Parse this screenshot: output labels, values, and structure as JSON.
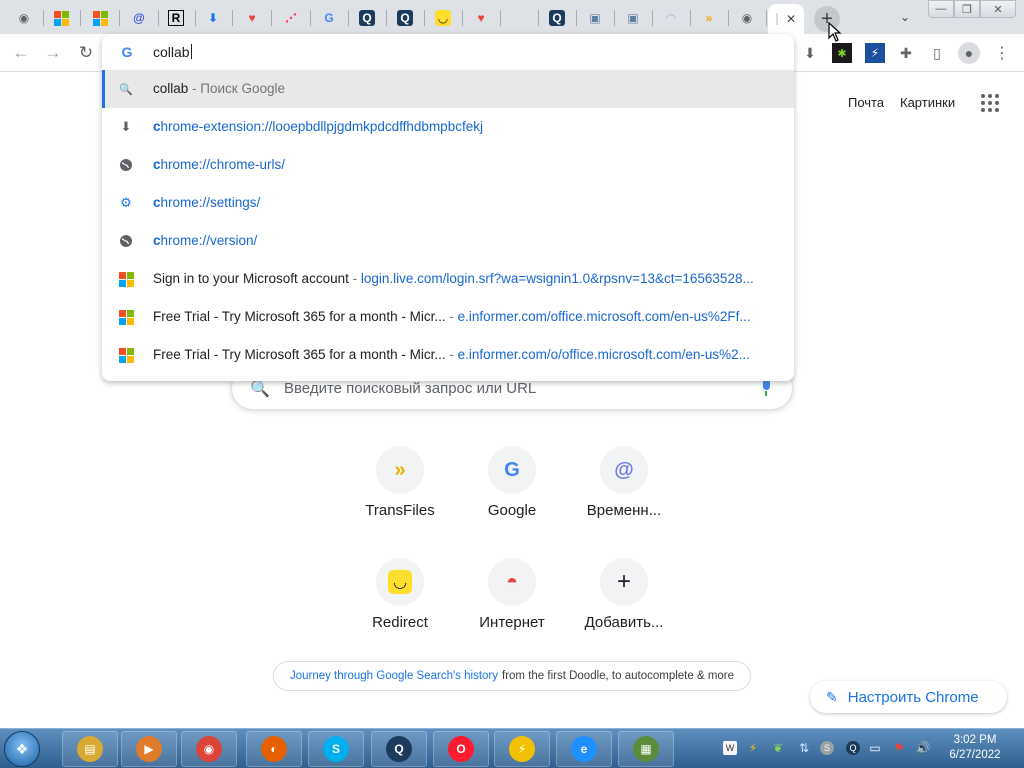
{
  "tabs": [
    {
      "icon": "chrome-icon",
      "glyph": "◉",
      "color": "#5f6368"
    },
    {
      "icon": "microsoft-icon",
      "glyph": "ms",
      "color": ""
    },
    {
      "icon": "microsoft-icon",
      "glyph": "ms",
      "color": ""
    },
    {
      "icon": "at-sign-icon",
      "glyph": "@",
      "color": "#3c50e0"
    },
    {
      "icon": "r-logo-icon",
      "glyph": "R",
      "color": "#000000"
    },
    {
      "icon": "download-icon",
      "glyph": "⬇",
      "color": "#1a73e8"
    },
    {
      "icon": "heart-app-icon",
      "glyph": "♥",
      "color": "#e8453c"
    },
    {
      "icon": "monday-icon",
      "glyph": "⋰",
      "color": "#ff3d57"
    },
    {
      "icon": "google-icon",
      "glyph": "G",
      "color": "#4285f4"
    },
    {
      "icon": "q-search-icon",
      "glyph": "Q",
      "color": "#1b3a5c"
    },
    {
      "icon": "q-search-icon",
      "glyph": "Q",
      "color": "#1b3a5c"
    },
    {
      "icon": "smile-icon",
      "glyph": "◡",
      "color": "#222222"
    },
    {
      "icon": "heart-app-icon",
      "glyph": "♥",
      "color": "#e8453c"
    },
    {
      "icon": "blank-tab-icon",
      "glyph": "",
      "color": "#5f6368"
    },
    {
      "icon": "q-search-icon",
      "glyph": "Q",
      "color": "#1b3a5c"
    },
    {
      "icon": "box-icon",
      "glyph": "▣",
      "color": "#5f7fa0"
    },
    {
      "icon": "box-icon",
      "glyph": "▣",
      "color": "#5f7fa0"
    },
    {
      "icon": "arc-icon",
      "glyph": "◠",
      "color": "#9fb3d9"
    },
    {
      "icon": "transfiles-icon",
      "glyph": "»",
      "color": "#f2a900"
    },
    {
      "icon": "chrome-icon",
      "glyph": "◉",
      "color": "#5f6368"
    }
  ],
  "active_tab": {
    "close": "✕"
  },
  "new_tab": "+",
  "tab_search": "⌄",
  "window_controls": {
    "minimize": "—",
    "maximize": "❐",
    "close": "✕"
  },
  "toolbar": {
    "back": "←",
    "forward": "→",
    "reload": "↻"
  },
  "omnibox": {
    "input_value": "collab",
    "suggestions": [
      {
        "kind": "search",
        "icon": "search-icon",
        "glyph": "🔍",
        "main": "collab",
        "suffix": " - Поиск Google",
        "selected": true
      },
      {
        "kind": "download",
        "icon": "download-icon",
        "glyph": "⬇",
        "bold": "c",
        "url": "hrome-extension://looepbdllpjgdmkpdcdffhdbmpbcfekj"
      },
      {
        "kind": "globe",
        "icon": "globe-icon",
        "glyph": "🌐",
        "bold": "c",
        "url": "hrome://chrome-urls/"
      },
      {
        "kind": "gear",
        "icon": "gear-icon",
        "glyph": "⚙",
        "bold": "c",
        "url": "hrome://settings/"
      },
      {
        "kind": "globe",
        "icon": "globe-icon",
        "glyph": "🌐",
        "bold": "c",
        "url": "hrome://version/"
      },
      {
        "kind": "ms",
        "icon": "microsoft-icon",
        "title": "Sign in to your Microsoft account",
        "sep": " - ",
        "url": "login.live.com/login.srf?wa=wsignin1.0&rpsnv=13&ct=16563528..."
      },
      {
        "kind": "ms",
        "icon": "microsoft-icon",
        "title": "Free Trial - Try Microsoft 365 for a month - Micr...",
        "sep": " - ",
        "url": "e.informer.com/office.microsoft.com/en-us%2Ff..."
      },
      {
        "kind": "ms",
        "icon": "microsoft-icon",
        "title": "Free Trial - Try Microsoft 365 for a month - Micr...",
        "sep": " - ",
        "url": "e.informer.com/o/office.microsoft.com/en-us%2..."
      }
    ]
  },
  "ntp": {
    "links": {
      "mail": "Почта",
      "images": "Картинки"
    },
    "search_placeholder": "Введите поисковый запрос или URL",
    "tiles": [
      {
        "label": "TransFiles",
        "glyph": "»",
        "color": "#f2a900"
      },
      {
        "label": "Google",
        "glyph": "G",
        "color": "#4285f4"
      },
      {
        "label": "Временн...",
        "glyph": "@",
        "color": "#6b7ce8"
      },
      {
        "label": "Redirect",
        "glyph": "◡",
        "color": "#222222"
      },
      {
        "label": "Интернет",
        "glyph": "◓",
        "color": "#e8453c"
      },
      {
        "label": "Добавить...",
        "glyph": "+",
        "color": "#202124"
      }
    ],
    "doodle": {
      "link": "Journey through Google Search's history",
      "text": "from the first Doodle, to autocomplete & more"
    },
    "customize": "Настроить Chrome"
  },
  "taskbar": {
    "clock_time": "3:02 PM",
    "clock_date": "6/27/2022",
    "apps": [
      {
        "name": "file-explorer-icon",
        "color": "#d9a934",
        "glyph": "▤"
      },
      {
        "name": "media-player-icon",
        "color": "#e07b2a",
        "glyph": "▶"
      },
      {
        "name": "chrome-icon",
        "color": "#db4437",
        "glyph": "◉"
      },
      {
        "name": "firefox-icon",
        "color": "#e66000",
        "glyph": "◐"
      },
      {
        "name": "skype-icon",
        "color": "#00aff0",
        "glyph": "S"
      },
      {
        "name": "q-search-icon",
        "color": "#1b3a5c",
        "glyph": "Q"
      },
      {
        "name": "opera-icon",
        "color": "#ff1b2d",
        "glyph": "O"
      },
      {
        "name": "lightning-app-icon",
        "color": "#f2c200",
        "glyph": "⚡"
      },
      {
        "name": "ie-icon",
        "color": "#1e90ff",
        "glyph": "e"
      },
      {
        "name": "minecraft-icon",
        "color": "#5a8c3a",
        "glyph": "▦"
      }
    ]
  }
}
